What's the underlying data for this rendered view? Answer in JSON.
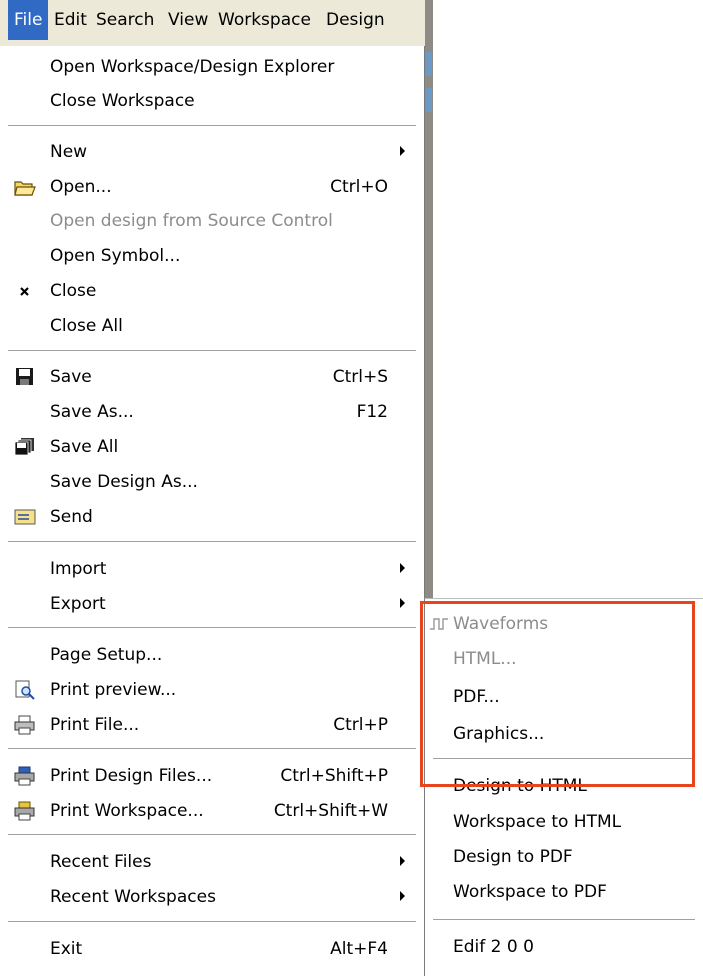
{
  "menubar": {
    "items": [
      "File",
      "Edit",
      "Search",
      "View",
      "Workspace",
      "Design"
    ]
  },
  "file_menu": {
    "open_explorer": "Open Workspace/Design Explorer",
    "close_workspace": "Close Workspace",
    "new": "New",
    "open": "Open...",
    "open_shortcut": "Ctrl+O",
    "open_source_control": "Open design from Source Control",
    "open_symbol": "Open Symbol...",
    "close": "Close",
    "close_all": "Close All",
    "save": "Save",
    "save_shortcut": "Ctrl+S",
    "save_as": "Save As...",
    "save_as_shortcut": "F12",
    "save_all": "Save All",
    "save_design_as": "Save Design As...",
    "send": "Send",
    "import": "Import",
    "export": "Export",
    "page_setup": "Page Setup...",
    "print_preview": "Print preview...",
    "print_file": "Print File...",
    "print_file_shortcut": "Ctrl+P",
    "print_design_files": "Print Design Files...",
    "print_design_files_shortcut": "Ctrl+Shift+P",
    "print_workspace": "Print Workspace...",
    "print_workspace_shortcut": "Ctrl+Shift+W",
    "recent_files": "Recent Files",
    "recent_workspaces": "Recent Workspaces",
    "exit": "Exit",
    "exit_shortcut": "Alt+F4"
  },
  "export_submenu": {
    "waveforms": "Waveforms",
    "html": "HTML...",
    "pdf": "PDF...",
    "graphics": "Graphics...",
    "design_to_html": "Design to HTML",
    "workspace_to_html": "Workspace to HTML",
    "design_to_pdf": "Design to PDF",
    "workspace_to_pdf": "Workspace to PDF",
    "edif": "Edif 2 0 0"
  },
  "colors": {
    "menubar_active": "#316ac5",
    "highlight_box": "#e8451e",
    "disabled_text": "#8c8c8c"
  }
}
